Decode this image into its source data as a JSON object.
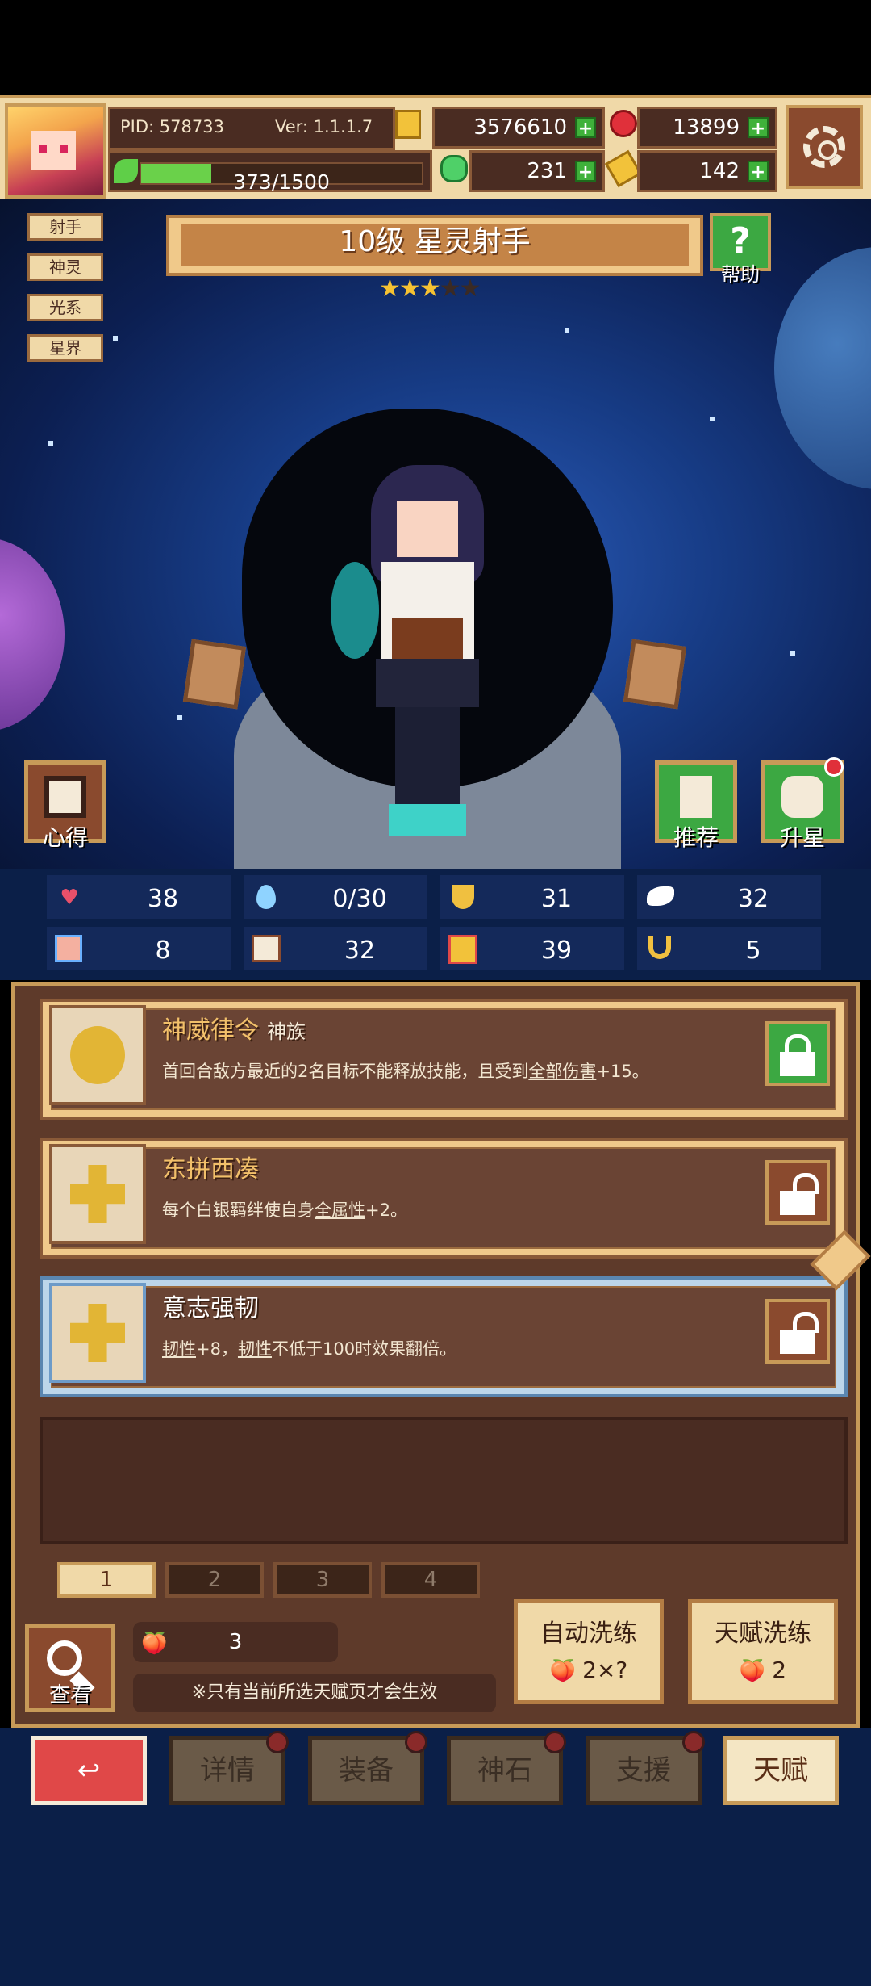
{
  "topbar": {
    "pid": "PID: 578733",
    "ver": "Ver: 1.1.1.7",
    "xp_text": "373/1500",
    "xp_fraction": 0.249,
    "gold": "3576610",
    "rubies": "13899",
    "clovers": "231",
    "keys": "142",
    "plus": "+"
  },
  "tags": [
    "射手",
    "神灵",
    "光系",
    "星界"
  ],
  "title": "10级  星灵射手",
  "stars_total": 5,
  "stars_filled": 3,
  "star_glyph": "★",
  "help_icon": "?",
  "help_label": "帮助",
  "buttons": {
    "xinde": "心得",
    "tuijian": "推荐",
    "shengxing": "升星"
  },
  "stats": {
    "row1": [
      {
        "icon": "heart-icon",
        "glyph": "♥",
        "color": "#e8506a",
        "value": "38"
      },
      {
        "icon": "mana-drop-icon",
        "glyph": "💧",
        "color": "#8fd3ff",
        "value": "0/30"
      },
      {
        "icon": "shield-icon",
        "glyph": "🛡",
        "color": "#f0c040",
        "value": "31"
      },
      {
        "icon": "wing-icon",
        "glyph": "🕊",
        "color": "#ffffff",
        "value": "32"
      }
    ],
    "row2": [
      {
        "icon": "fist-icon",
        "glyph": "✊",
        "color": "#f4b0a0",
        "value": "8"
      },
      {
        "icon": "book-icon",
        "glyph": "📖",
        "color": "#f4ead8",
        "value": "32"
      },
      {
        "icon": "boot-icon",
        "glyph": "👢",
        "color": "#e04848",
        "value": "39"
      },
      {
        "icon": "horseshoe-icon",
        "glyph": "∩",
        "color": "#f0c040",
        "value": "5"
      }
    ]
  },
  "talents": [
    {
      "name": "神威律令",
      "sub": "神族",
      "desc_pre": "首回合敌方最近的2名目标不能释放技能，且受到",
      "desc_link": "全部伤害",
      "desc_post": "+15。",
      "lock": "green"
    },
    {
      "name": "东拼西凑",
      "sub": "",
      "desc_pre": "每个白银羁绊使自身",
      "desc_link": "全属性",
      "desc_post": "+2。",
      "lock": "brown"
    },
    {
      "name": "意志强韧",
      "sub": "",
      "desc_pre": "",
      "desc_link": "韧性",
      "desc_post": "+8，",
      "desc_link2": "韧性",
      "desc_post2": "不低于100时效果翻倍。",
      "lock": "brown"
    }
  ],
  "pages": [
    "1",
    "2",
    "3",
    "4"
  ],
  "active_page": 0,
  "view_label": "查看",
  "fruit_count": "3",
  "note": "※只有当前所选天赋页才会生效",
  "auto_refine": {
    "label": "自动洗练",
    "cost": "2×?"
  },
  "talent_refine": {
    "label": "天赋洗练",
    "cost": "2"
  },
  "nav": [
    "详情",
    "装备",
    "神石",
    "支援",
    "天赋"
  ],
  "back_glyph": "↩",
  "fruit_glyph": "🍑"
}
